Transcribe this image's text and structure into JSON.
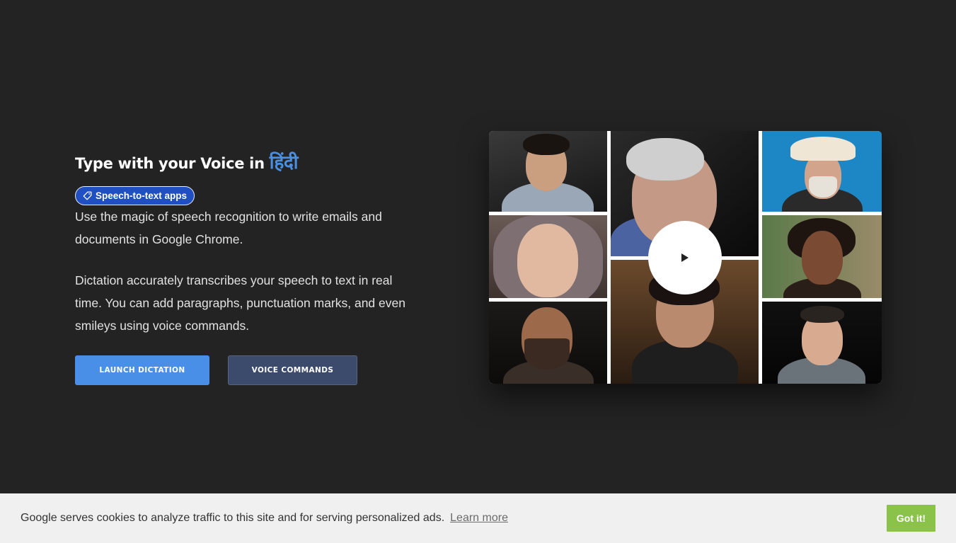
{
  "hero": {
    "title_prefix": "Type with your Voice in ",
    "title_language": "हिंदी",
    "tag_label": "Speech-to-text apps",
    "description_1": "Use the magic of speech recognition to write emails and documents in Google Chrome.",
    "description_2": "Dictation accurately transcribes your speech to text in real time. You can add paragraphs, punctuation marks, and even smileys using voice commands."
  },
  "buttons": {
    "launch_label": "LAUNCH DICTATION",
    "voice_commands_label": "VOICE COMMANDS"
  },
  "video": {
    "play_icon": "play-icon"
  },
  "cookie": {
    "message": "Google serves cookies to analyze traffic to this site and for serving personalized ads.",
    "learn_more": "Learn more",
    "accept_label": "Got it!"
  },
  "colors": {
    "background": "#232323",
    "accent_blue": "#4a8fe7",
    "secondary_button": "#3c4b6b",
    "tag_blue": "#1f4fc0",
    "cookie_accept": "#8bc34a"
  }
}
